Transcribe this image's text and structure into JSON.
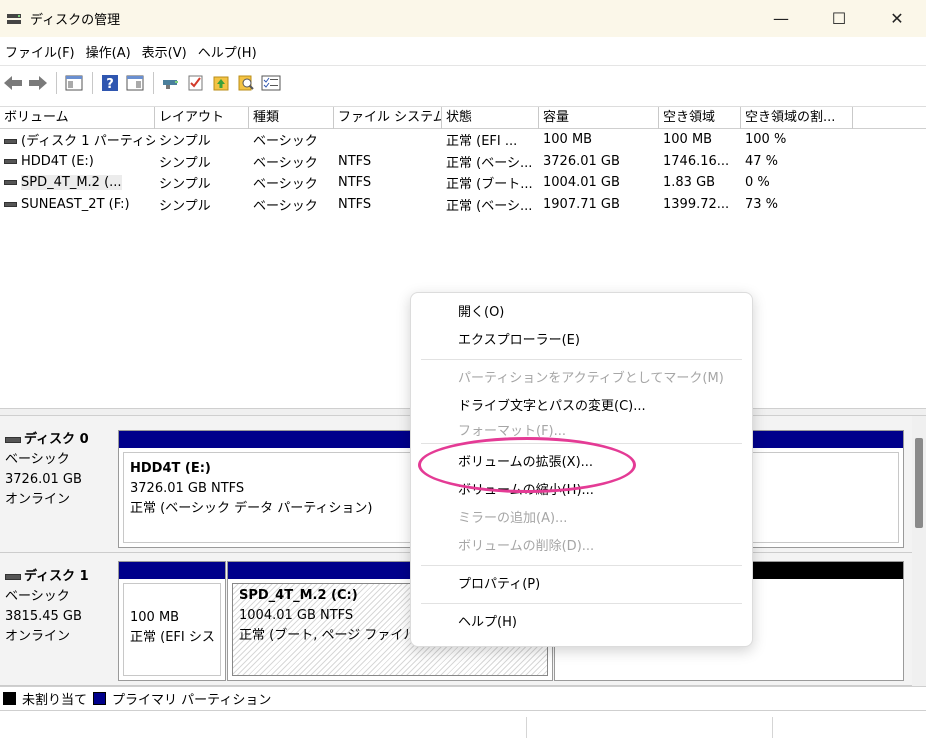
{
  "window": {
    "title": "ディスクの管理",
    "app_icon": "disk-management-icon",
    "controls": {
      "minimize": "—",
      "maximize": "☐",
      "close": "✕"
    }
  },
  "menu": [
    "ファイル(F)",
    "操作(A)",
    "表示(V)",
    "ヘルプ(H)"
  ],
  "toolbar": [
    "back-arrow-icon",
    "forward-arrow-icon",
    "console-tree-icon",
    "help-icon",
    "action-pane-icon",
    "connect-icon",
    "check-icon",
    "import-icon",
    "search-icon",
    "properties-icon"
  ],
  "volume_table": {
    "columns": [
      "ボリューム",
      "レイアウト",
      "種類",
      "ファイル システム",
      "状態",
      "容量",
      "空き領域",
      "空き領域の割..."
    ],
    "rows": [
      [
        "(ディスク 1 パーティショ...",
        "シンプル",
        "ベーシック",
        "",
        "正常 (EFI ...",
        "100 MB",
        "100 MB",
        "100 %"
      ],
      [
        "HDD4T (E:)",
        "シンプル",
        "ベーシック",
        "NTFS",
        "正常 (ベーシ...",
        "3726.01 GB",
        "1746.16...",
        "47 %"
      ],
      [
        "SPD_4T_M.2 (...",
        "シンプル",
        "ベーシック",
        "NTFS",
        "正常 (ブート...",
        "1004.01 GB",
        "1.83 GB",
        "0 %"
      ],
      [
        "SUNEAST_2T (F:)",
        "シンプル",
        "ベーシック",
        "NTFS",
        "正常 (ベーシ...",
        "1907.71 GB",
        "1399.72...",
        "73 %"
      ]
    ]
  },
  "disks": [
    {
      "name": "ディスク 0",
      "type": "ベーシック",
      "size": "3726.01 GB",
      "status": "オンライン",
      "partitions": [
        {
          "name": "HDD4T  (E:)",
          "size": "3726.01 GB NTFS",
          "status": "正常 (ベーシック データ パーティション)"
        }
      ]
    },
    {
      "name": "ディスク 1",
      "type": "ベーシック",
      "size": "3815.45 GB",
      "status": "オンライン",
      "partitions": [
        {
          "name": "",
          "size": "100 MB",
          "status": "正常 (EFI シス"
        },
        {
          "name": "SPD_4T_M.2  (C:)",
          "size": "1004.01 GB NTFS",
          "status": "正常 (ブート, ページ ファイル, ク"
        }
      ]
    }
  ],
  "legend": [
    "未割り当て",
    "プライマリ パーティション"
  ],
  "legend_colors": {
    "unallocated": "#000000",
    "primary": "#00008b"
  },
  "context_menu": {
    "items": [
      {
        "label": "開く(O)",
        "enabled": true
      },
      {
        "label": "エクスプローラー(E)",
        "enabled": true
      },
      {
        "label": "パーティションをアクティブとしてマーク(M)",
        "enabled": false
      },
      {
        "label": "ドライブ文字とパスの変更(C)...",
        "enabled": true
      },
      {
        "label": "フォーマット(F)...",
        "enabled": false
      },
      {
        "label": "ボリュームの拡張(X)...",
        "enabled": true
      },
      {
        "label": "ボリュームの縮小(H)...",
        "enabled": true
      },
      {
        "label": "ミラーの追加(A)...",
        "enabled": false
      },
      {
        "label": "ボリュームの削除(D)...",
        "enabled": false
      },
      {
        "label": "プロパティ(P)",
        "enabled": true
      },
      {
        "label": "ヘルプ(H)",
        "enabled": true
      }
    ]
  },
  "annotation_color": "#e43b95"
}
